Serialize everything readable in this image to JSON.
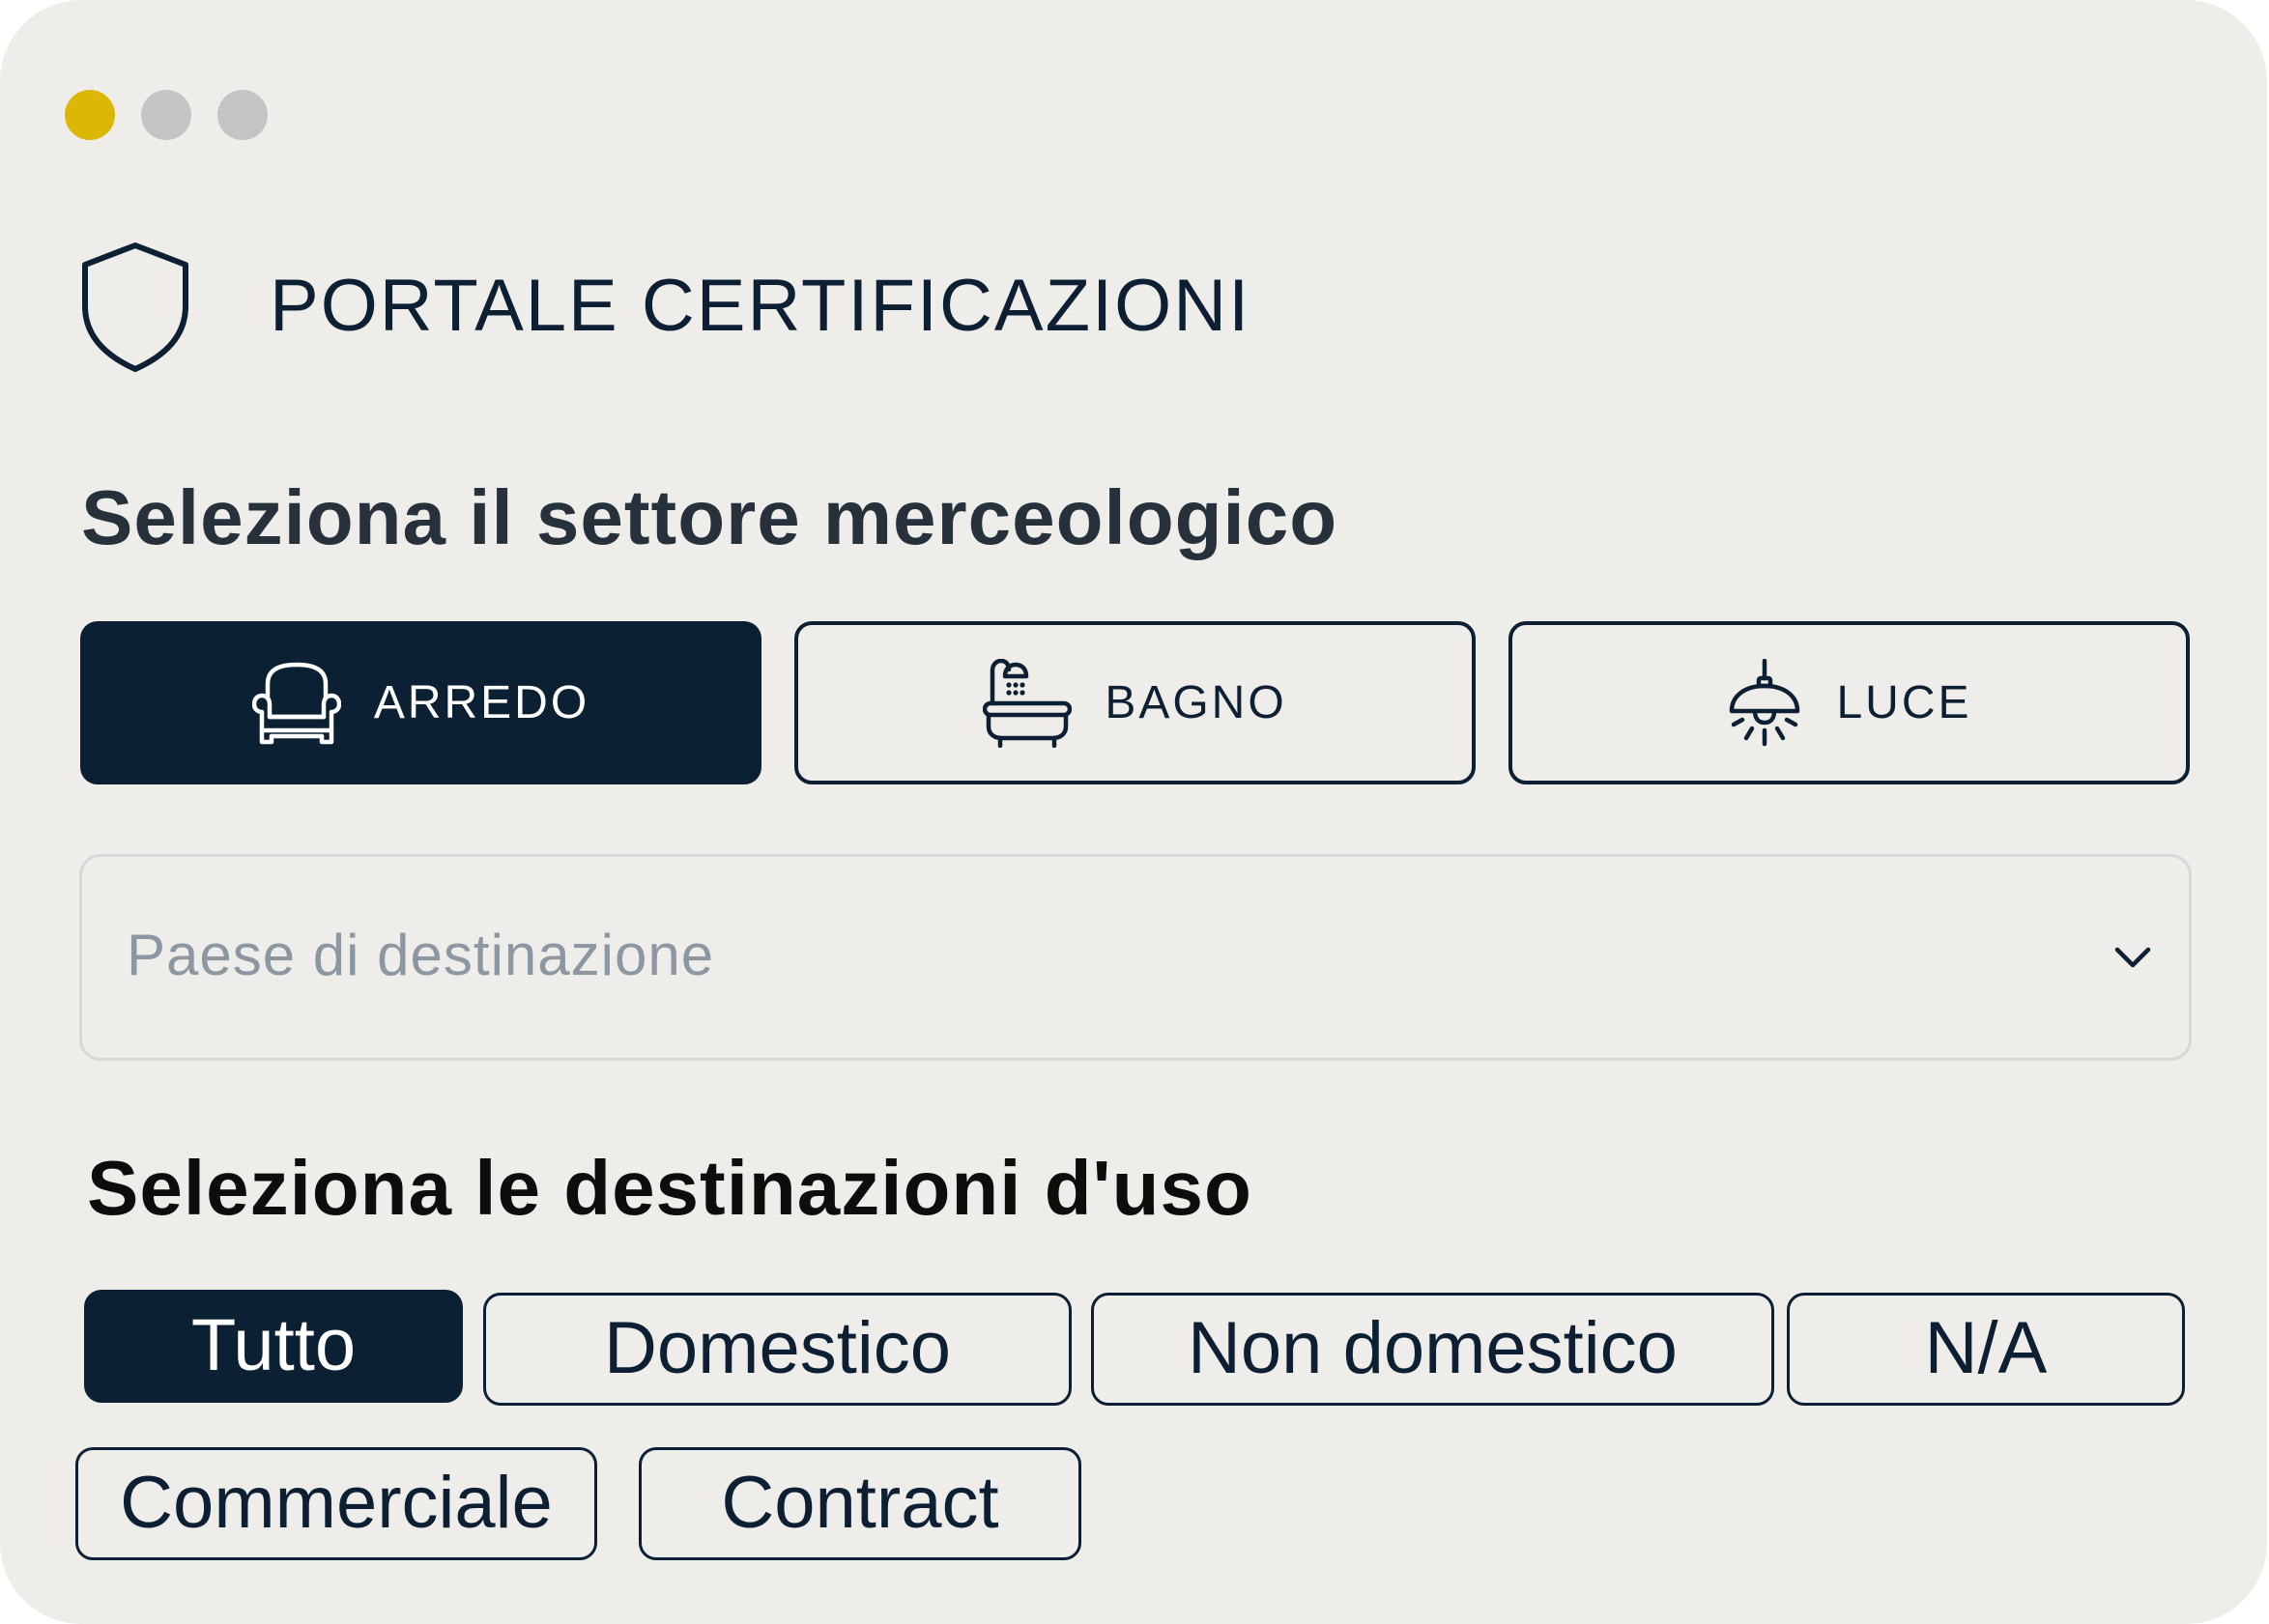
{
  "window": {
    "controls": [
      {
        "name": "yellow-dot",
        "color": "#DDB705"
      },
      {
        "name": "grey-dot",
        "color": "#C2C5C4"
      },
      {
        "name": "grey-dot",
        "color": "#C2C5C4"
      }
    ]
  },
  "header": {
    "icon": "shield-icon",
    "title": "PORTALE CERTIFICAZIONI"
  },
  "sector": {
    "heading": "Seleziona il settore merceologico",
    "options": [
      {
        "label": "ARREDO",
        "icon": "armchair-icon",
        "selected": true
      },
      {
        "label": "BAGNO",
        "icon": "bathtub-icon",
        "selected": false
      },
      {
        "label": "LUCE",
        "icon": "ceiling-lamp-icon",
        "selected": false
      }
    ]
  },
  "destination_country": {
    "placeholder": "Paese di destinazione",
    "value": "",
    "icon": "chevron-down-icon"
  },
  "usage": {
    "heading": "Seleziona le destinazioni d'uso",
    "options": [
      {
        "label": "Tutto",
        "selected": true
      },
      {
        "label": "Domestico",
        "selected": false
      },
      {
        "label": "Non domestico",
        "selected": false
      },
      {
        "label": "N/A",
        "selected": false
      },
      {
        "label": "Commerciale",
        "selected": false
      },
      {
        "label": "Contract",
        "selected": false
      }
    ]
  },
  "colors": {
    "background": "#EFEDEA",
    "primary": "#0C2033",
    "accent": "#DDB705",
    "placeholder": "#8C97A1"
  }
}
